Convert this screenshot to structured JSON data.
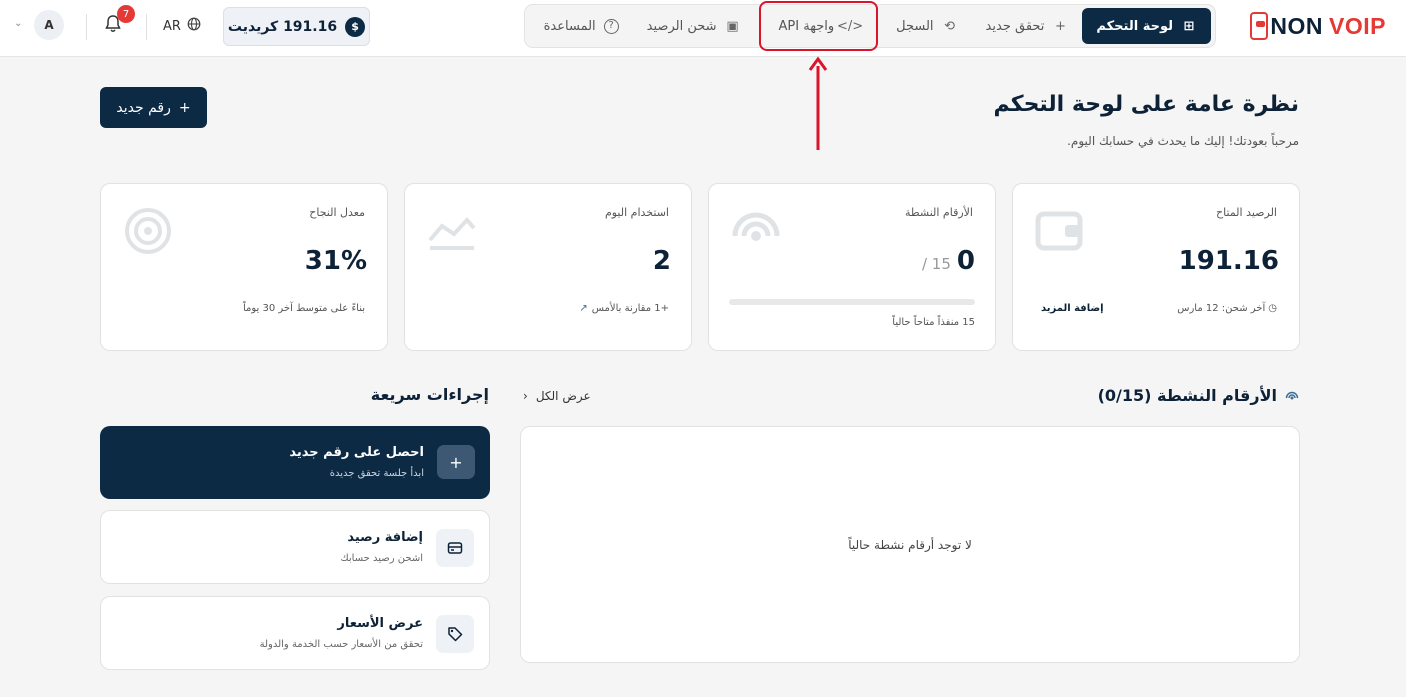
{
  "header": {
    "logo": {
      "part1": "NON",
      "part2": "VOIP"
    },
    "nav": [
      {
        "label": "لوحة التحكم",
        "icon": "dashboard-icon",
        "glyph": "⊞",
        "active": true
      },
      {
        "label": "تحقق جديد",
        "icon": "plus-icon",
        "glyph": "+",
        "active": false
      },
      {
        "label": "السجل",
        "icon": "history-icon",
        "glyph": "⟲",
        "active": false
      },
      {
        "label": "واجهة API",
        "icon": "code-icon",
        "glyph": "</>",
        "active": false
      },
      {
        "label": "شحن الرصيد",
        "icon": "wallet-icon",
        "glyph": "▣",
        "active": false
      },
      {
        "label": "المساعدة",
        "icon": "help-icon",
        "glyph": "?",
        "active": false
      }
    ],
    "credit": {
      "amount": "191.16 كريديت",
      "coin": "$"
    },
    "language": "AR",
    "notifications": "7",
    "avatar": "A"
  },
  "page": {
    "title": "نظرة عامة على لوحة التحكم",
    "subtitle": "مرحباً بعودتك! إليك ما يحدث في حسابك اليوم.",
    "new_button": "رقم جديد"
  },
  "stats": {
    "balance": {
      "label": "الرصيد المتاح",
      "value": "191.16",
      "foot": "آخر شحن: 12 مارس",
      "link": "إضافة المزيد"
    },
    "active": {
      "label": "الأرقام النشطة",
      "value": "0",
      "total": "/ 15",
      "progress": 0,
      "foot": "15 منفذاً متاحاً حالياً"
    },
    "usage": {
      "label": "استخدام اليوم",
      "value": "2",
      "foot": "+1 مقارنة بالأمس"
    },
    "success": {
      "label": "معدل النجاح",
      "value": "31%",
      "foot": "بناءً على متوسط آخر 30 يوماً"
    }
  },
  "active_numbers": {
    "title": "الأرقام النشطة (0/15)",
    "view_all": "عرض الكل",
    "empty": "لا توجد أرقام نشطة حالياً"
  },
  "quick_actions": {
    "title": "إجراءات سريعة",
    "items": [
      {
        "title": "احصل على رقم جديد",
        "subtitle": "ابدأ جلسة تحقق جديدة"
      },
      {
        "title": "إضافة رصيد",
        "subtitle": "اشحن رصيد حسابك"
      },
      {
        "title": "عرض الأسعار",
        "subtitle": "تحقق من الأسعار حسب الخدمة والدولة"
      }
    ]
  },
  "colors": {
    "primary": "#0d2a45",
    "accent": "#e53935",
    "highlight": "#d9142b",
    "background": "#f5f5f5"
  }
}
